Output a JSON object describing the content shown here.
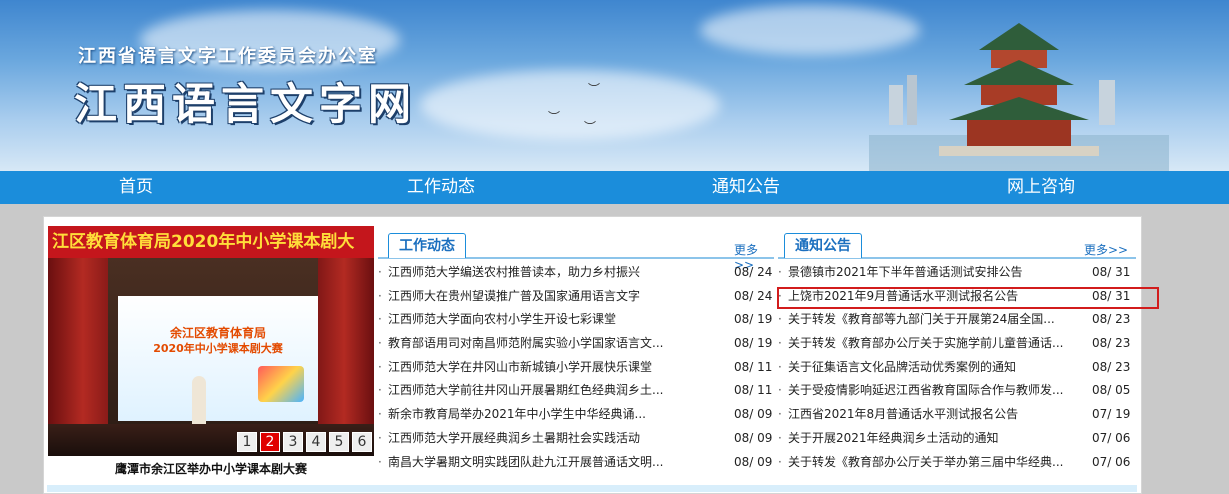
{
  "banner": {
    "subtitle": "江西省语言文字工作委员会办公室",
    "title": "江西语言文字网"
  },
  "nav": [
    {
      "label": "首页"
    },
    {
      "label": "工作动态"
    },
    {
      "label": "通知公告"
    },
    {
      "label": "网上咨询"
    }
  ],
  "slideshow": {
    "banner_text": "江区教育体育局2020年中小学课本剧大",
    "screen_line1": "余江区教育体育局",
    "screen_line2": "2020年中小学课本剧大赛",
    "caption": "鹰潭市余江区举办中小学课本剧大赛",
    "pages": [
      "1",
      "2",
      "3",
      "4",
      "5",
      "6"
    ],
    "active_page": "2"
  },
  "work_news": {
    "tab": "工作动态",
    "more": "更多>>",
    "items": [
      {
        "title": "江西师范大学编送农村推普读本，助力乡村振兴",
        "date": "08/ 24"
      },
      {
        "title": "江西师大在贵州望谟推广普及国家通用语言文字",
        "date": "08/ 24"
      },
      {
        "title": "江西师范大学面向农村小学生开设七彩课堂",
        "date": "08/ 19"
      },
      {
        "title": "教育部语用司对南昌师范附属实验小学国家语言文...",
        "date": "08/ 19"
      },
      {
        "title": "江西师范大学在井冈山市新城镇小学开展快乐课堂",
        "date": "08/ 11"
      },
      {
        "title": "江西师范大学前往井冈山开展暑期红色经典润乡土...",
        "date": "08/ 11"
      },
      {
        "title": "新余市教育局举办2021年中小学生中华经典诵...",
        "date": "08/ 09"
      },
      {
        "title": "江西师范大学开展经典润乡土暑期社会实践活动",
        "date": "08/ 09"
      },
      {
        "title": "南昌大学暑期文明实践团队赴九江开展普通话文明...",
        "date": "08/ 09"
      }
    ]
  },
  "notices": {
    "tab": "通知公告",
    "more": "更多>>",
    "items": [
      {
        "title": "景德镇市2021年下半年普通话测试安排公告",
        "date": "08/ 31"
      },
      {
        "title": "上饶市2021年9月普通话水平测试报名公告",
        "date": "08/ 31"
      },
      {
        "title": "关于转发《教育部等九部门关于开展第24届全国...",
        "date": "08/ 23"
      },
      {
        "title": "关于转发《教育部办公厅关于实施学前儿童普通话...",
        "date": "08/ 23"
      },
      {
        "title": "关于征集语言文化品牌活动优秀案例的通知",
        "date": "08/ 23"
      },
      {
        "title": "关于受疫情影响延迟江西省教育国际合作与教师发...",
        "date": "08/ 05"
      },
      {
        "title": "江西省2021年8月普通话水平测试报名公告",
        "date": "07/ 19"
      },
      {
        "title": "关于开展2021年经典润乡土活动的通知",
        "date": "07/ 06"
      },
      {
        "title": "关于转发《教育部办公厅关于举办第三届中华经典...",
        "date": "07/ 06"
      }
    ]
  },
  "colors": {
    "nav_bg": "#1b8ddb",
    "highlight": "#d21c1c",
    "link": "#1b6fbf"
  }
}
